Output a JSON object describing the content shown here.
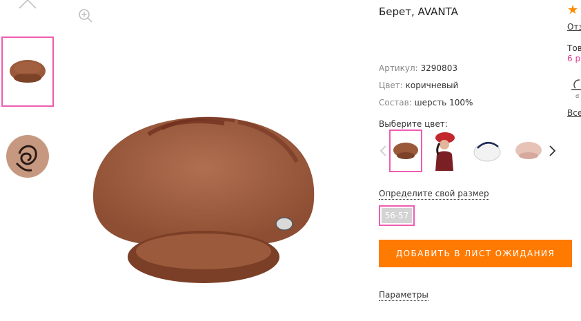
{
  "product": {
    "title": "Берет, AVANTA",
    "article_label": "Артикул:",
    "article_value": "3290803",
    "color_label": "Цвет:",
    "color_value": "коричневый",
    "composition_label": "Состав:",
    "composition_value": "шерсть 100%"
  },
  "color_picker": {
    "label": "Выберите цвет:",
    "options": [
      "brown-beret",
      "red-beret-model",
      "white-beret",
      "pink-beret"
    ]
  },
  "size": {
    "link_label": "Определите свой размер",
    "options": [
      "56-57"
    ]
  },
  "actions": {
    "add_label": "ДОБАВИТЬ В ЛИСТ ОЖИДАНИЯ",
    "params_label": "Параметры"
  },
  "side_column": {
    "reviews_partial": "Отз",
    "stock_partial": "Тов",
    "pink_partial": "6 р",
    "all_partial": "Все"
  },
  "colors": {
    "accent_orange": "#ff7a00",
    "highlight_pink": "#ef5cb0",
    "star": "#ff8a00",
    "size_chip": "#d3d3d3"
  }
}
